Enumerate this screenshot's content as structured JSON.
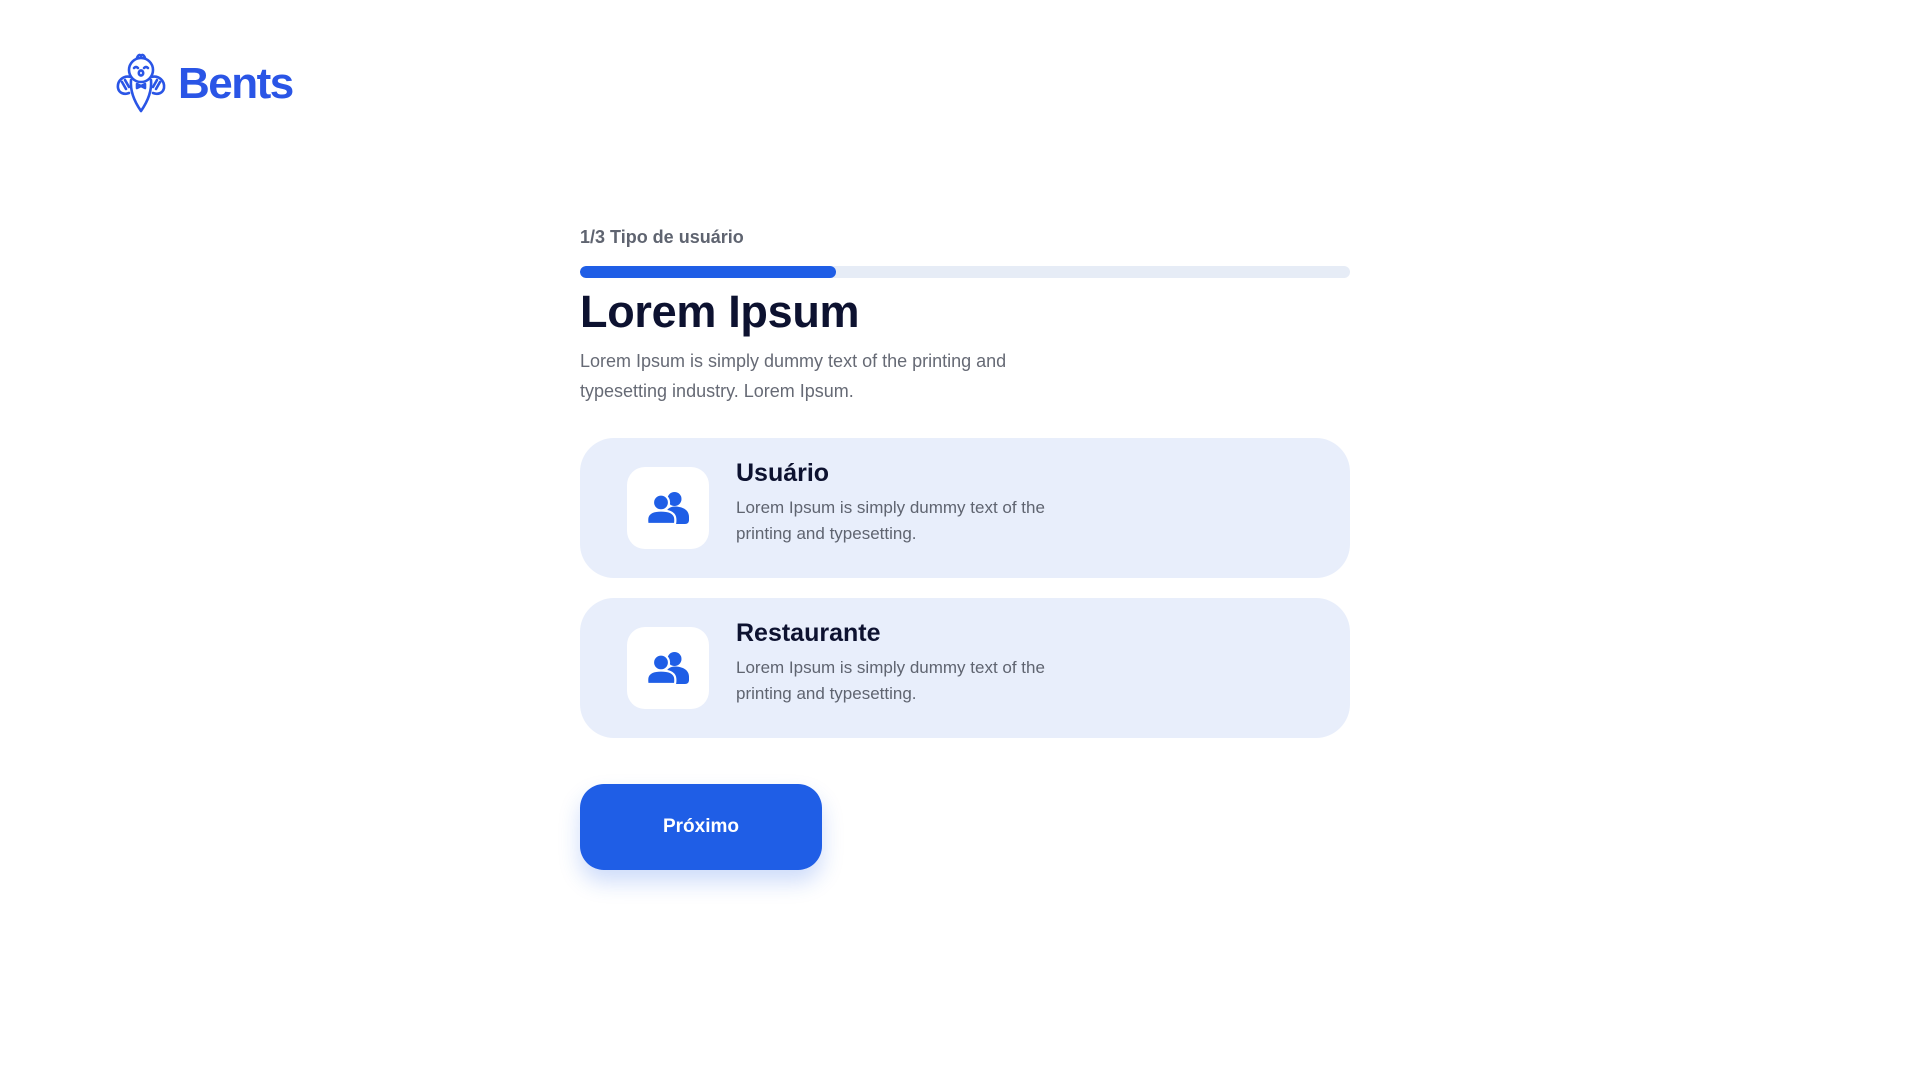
{
  "brand": {
    "name": "Bents",
    "logo_icon": "owl-mascot-icon",
    "color": "#2a55e6"
  },
  "step": {
    "label": "1/3 Tipo de usuário",
    "current": 1,
    "total": 3,
    "progress_fraction": 0.333
  },
  "header": {
    "title": "Lorem Ipsum",
    "subtitle": "Lorem Ipsum is simply dummy text of the printing and typesetting industry. Lorem Ipsum."
  },
  "options": [
    {
      "title": "Usuário",
      "description": "Lorem Ipsum is simply dummy text of the printing and typesetting.",
      "icon": "users-icon"
    },
    {
      "title": "Restaurante",
      "description": "Lorem Ipsum is simply dummy text of the printing and typesetting.",
      "icon": "users-icon"
    }
  ],
  "actions": {
    "next_label": "Próximo"
  },
  "colors": {
    "accent": "#1f5ee6",
    "card_background": "#e8eefb",
    "progress_track": "#e6ecf6",
    "heading_text": "#0d1230",
    "body_text": "#666a75"
  }
}
